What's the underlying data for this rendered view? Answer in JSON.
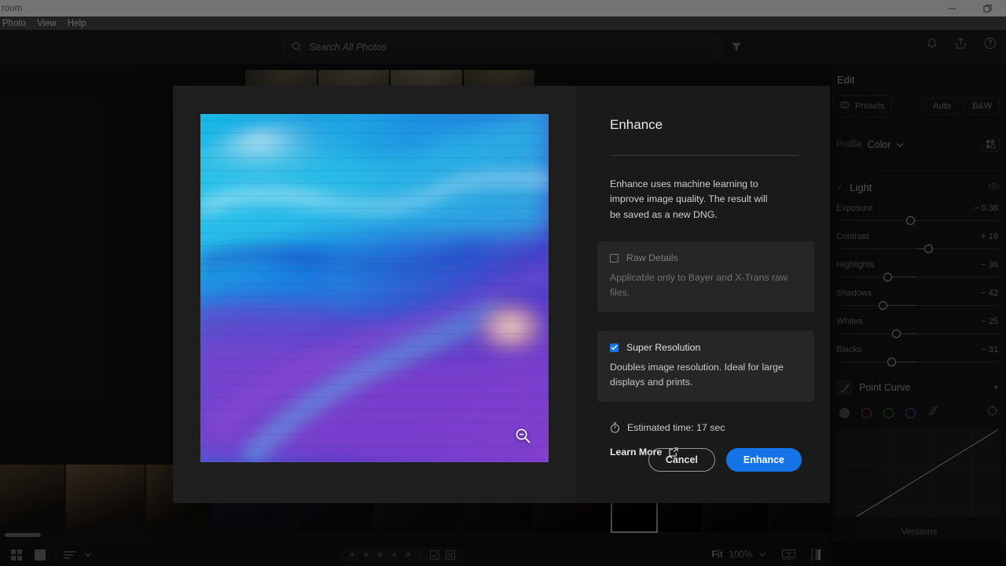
{
  "window": {
    "title": "room",
    "minimize_label": "Minimize",
    "maximize_label": "Restore",
    "menu": [
      {
        "label": "Photo"
      },
      {
        "label": "View"
      },
      {
        "label": "Help"
      }
    ]
  },
  "topbar": {
    "search_placeholder": "Search All Photos",
    "search_value": "",
    "search_icon": "search-icon",
    "filter_icon": "filter-funnel-icon",
    "notifications_icon": "bell-icon",
    "share_icon": "share-export-icon",
    "help_icon": "help-circle-icon"
  },
  "dialog": {
    "title": "Enhance",
    "description": "Enhance uses machine learning to improve image quality. The result will be saved as a new DNG.",
    "zoom_icon": "zoom-out-magnifier-icon",
    "options": [
      {
        "id": "raw-details",
        "label": "Raw Details",
        "description": "Applicable only to Bayer and X-Trans raw files.",
        "checked": false,
        "disabled": true
      },
      {
        "id": "super-resolution",
        "label": "Super Resolution",
        "description": "Doubles image resolution. Ideal for large displays and prints.",
        "checked": true,
        "disabled": false
      }
    ],
    "estimated_time": "Estimated time: 17 sec",
    "estimated_icon": "stopwatch-icon",
    "learn_more": "Learn More",
    "learn_more_icon": "external-link-icon",
    "cancel_label": "Cancel",
    "confirm_label": "Enhance",
    "accent_color": "#1473e6"
  },
  "edit_panel": {
    "title": "Edit",
    "presets_label": "Presets",
    "presets_icon": "presets-icon",
    "auto_label": "Auto",
    "bw_label": "B&W",
    "profile_label": "Profile",
    "profile_value": "Color",
    "profile_caret_icon": "chevron-down-icon",
    "profile_browser_icon": "profile-grid-search-icon",
    "light": {
      "name": "Light",
      "check_icon": "check-icon",
      "visibility_icon": "eye-icon",
      "sliders": [
        {
          "name": "Exposure",
          "value": "− 0.38",
          "pos": 46
        },
        {
          "name": "Contrast",
          "value": "+ 16",
          "pos": 57
        },
        {
          "name": "Highlights",
          "value": "− 36",
          "pos": 32
        },
        {
          "name": "Shadows",
          "value": "− 42",
          "pos": 29
        },
        {
          "name": "Whites",
          "value": "− 25",
          "pos": 37
        },
        {
          "name": "Blacks",
          "value": "− 31",
          "pos": 34
        }
      ]
    },
    "point_curve": {
      "name": "Point Curve",
      "icon": "curve-icon",
      "caret_icon": "chevron-down-icon",
      "channels": [
        {
          "name": "channel-rgb",
          "color": "#5a5a5a"
        },
        {
          "name": "channel-red",
          "color": "#b03a3a"
        },
        {
          "name": "channel-green",
          "color": "#3f9a46"
        },
        {
          "name": "channel-blue",
          "color": "#3f63b5"
        }
      ],
      "linear_icon": "linear-curve-icon",
      "target_icon": "targeted-adjustment-icon"
    },
    "versions_label": "Versions"
  },
  "bottombar": {
    "grid_icon": "grid-view-icon",
    "square_icon": "single-photo-icon",
    "sort_icon": "sort-lines-icon",
    "sort_caret_icon": "chevron-down-icon",
    "stars": [
      "★",
      "★",
      "★",
      "★",
      "★"
    ],
    "flag_pick_icon": "flag-pick-icon",
    "flag_reject_icon": "flag-reject-icon",
    "fit_label": "Fit",
    "zoom_value": "100%",
    "zoom_caret_icon": "chevron-down-icon",
    "filmstrip_icon": "filmstrip-toggle-icon",
    "compare_icon": "compare-view-icon"
  },
  "hero_strip": {
    "cells": [
      "#4a4436",
      "#5b5343",
      "#6b6050",
      "#57513f"
    ]
  },
  "filmstrip": {
    "thumbs": [
      {
        "width": 82,
        "selected": false,
        "tone": "#3a3026"
      },
      {
        "width": 100,
        "selected": false,
        "tone": "#453a2c"
      },
      {
        "width": 82,
        "selected": false,
        "tone": "#3d3327"
      },
      {
        "width": 110,
        "selected": false,
        "tone": "#2b2f3a"
      },
      {
        "width": 92,
        "selected": false,
        "tone": "#232733"
      },
      {
        "width": 112,
        "selected": false,
        "tone": "#2a2b2d"
      },
      {
        "width": 88,
        "selected": false,
        "tone": "#1f2124"
      },
      {
        "width": 96,
        "selected": false,
        "tone": "#26211c"
      },
      {
        "width": 58,
        "selected": true,
        "tone": "#0f0d0c"
      },
      {
        "width": 55,
        "selected": false,
        "tone": "#1a1715"
      },
      {
        "width": 82,
        "selected": false,
        "tone": "#201e1c"
      },
      {
        "width": 84,
        "selected": false,
        "tone": "#26211d"
      },
      {
        "width": 57,
        "selected": false,
        "tone": "#2b231d"
      },
      {
        "width": 58,
        "selected": false,
        "tone": "#231f1d"
      },
      {
        "width": 50,
        "selected": false,
        "tone": "#1c1d24"
      },
      {
        "width": 40,
        "selected": false,
        "tone": "#17181c"
      }
    ]
  }
}
